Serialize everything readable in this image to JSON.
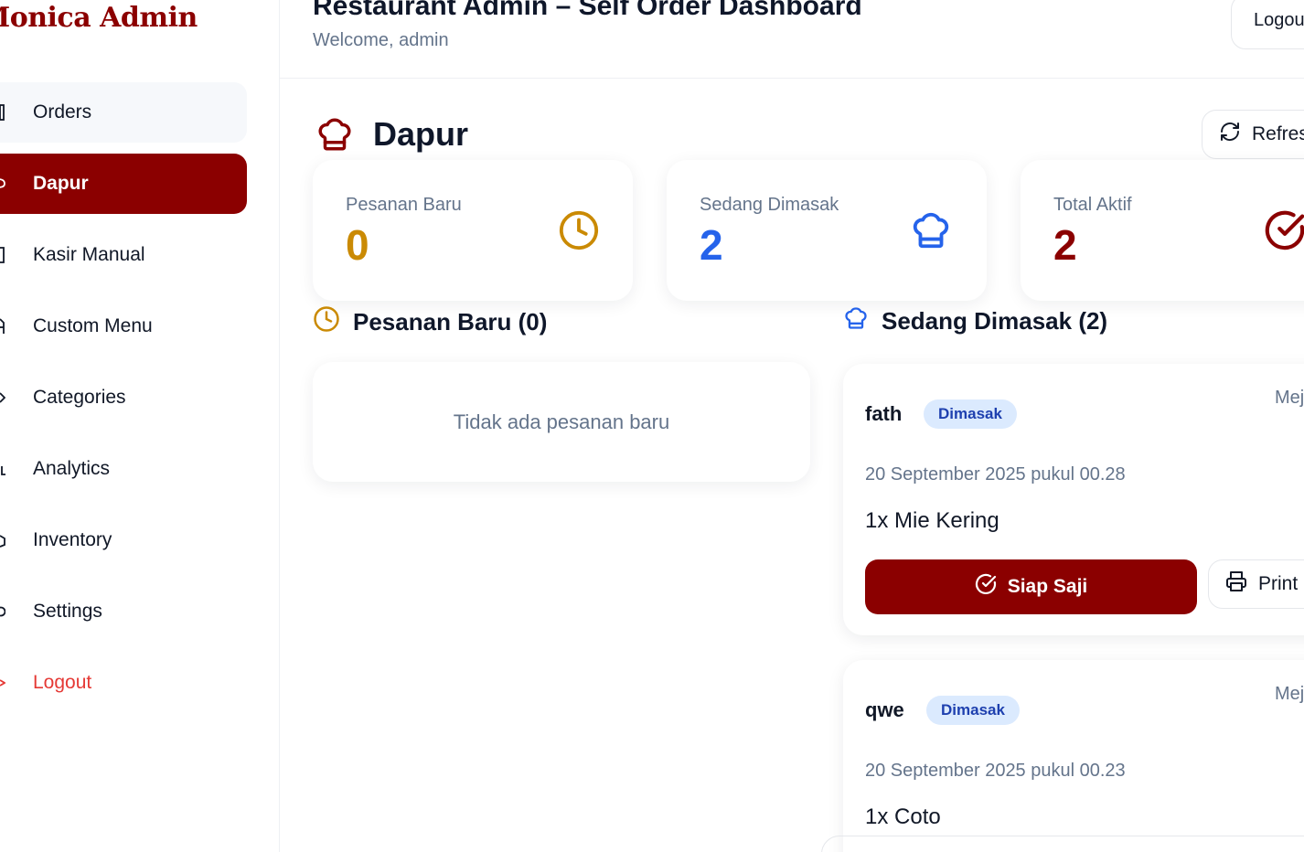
{
  "sidebar": {
    "brand": "Monica Admin",
    "items": [
      {
        "label": "Orders",
        "icon": "orders-icon"
      },
      {
        "label": "Dapur",
        "icon": "chef-hat-icon"
      },
      {
        "label": "Kasir Manual",
        "icon": "cashier-icon"
      },
      {
        "label": "Custom Menu",
        "icon": "menu-icon"
      },
      {
        "label": "Categories",
        "icon": "tag-icon"
      },
      {
        "label": "Analytics",
        "icon": "chart-icon"
      },
      {
        "label": "Inventory",
        "icon": "box-icon"
      },
      {
        "label": "Settings",
        "icon": "gear-icon"
      },
      {
        "label": "Logout",
        "icon": "logout-icon"
      }
    ],
    "active": "Dapur"
  },
  "header": {
    "title": "Restaurant Admin – Self Order Dashboard",
    "subtitle": "Welcome, admin",
    "logout_label": "Logout"
  },
  "page": {
    "title": "Dapur",
    "refresh_label": "Refresh"
  },
  "stats": [
    {
      "label": "Pesanan Baru",
      "value": "0",
      "color": "#ca8a04",
      "icon": "clock-icon"
    },
    {
      "label": "Sedang Dimasak",
      "value": "2",
      "color": "#2563eb",
      "icon": "chef-hat-icon"
    },
    {
      "label": "Total Aktif",
      "value": "2",
      "color": "#8b0000",
      "icon": "check-circle-icon"
    }
  ],
  "sections": {
    "new_orders": {
      "title": "Pesanan Baru (0)",
      "empty_text": "Tidak ada pesanan baru"
    },
    "cooking": {
      "title": "Sedang Dimasak (2)"
    }
  },
  "orders": [
    {
      "name": "fath",
      "status": "Dimasak",
      "meta": "Meja",
      "time": "20 September 2025 pukul 00.28",
      "item": "1x Mie Kering",
      "ready_label": "Siap Saji",
      "print_label": "Print"
    },
    {
      "name": "qwe",
      "status": "Dimasak",
      "meta": "Meja",
      "time": "20 September 2025 pukul 00.23",
      "item": "1x Coto"
    }
  ],
  "colors": {
    "brand": "#8b0000",
    "yellow": "#ca8a04",
    "blue": "#2563eb",
    "danger": "#e53935"
  }
}
